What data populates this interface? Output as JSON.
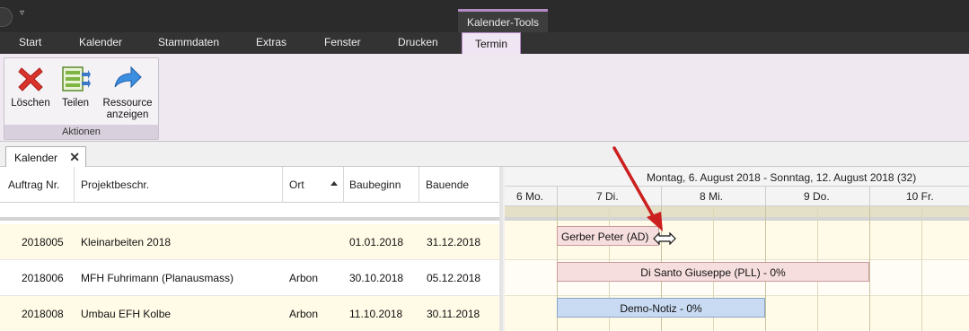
{
  "ribbon_tabs": [
    "Start",
    "Kalender",
    "Stammdaten",
    "Extras",
    "Fenster",
    "Drucken",
    "Termin"
  ],
  "context_group": "Kalender-Tools",
  "actions_group": {
    "label": "Aktionen",
    "buttons": [
      {
        "label": "Löschen",
        "icon": "delete-x-icon"
      },
      {
        "label": "Teilen",
        "icon": "split-icon"
      },
      {
        "label_line1": "Ressource",
        "label_line2": "anzeigen",
        "icon": "arrow-right-icon"
      }
    ]
  },
  "document_tab": {
    "label": "Kalender",
    "close": "✕"
  },
  "grid": {
    "columns": [
      "Auftrag Nr.",
      "Projektbeschr.",
      "Ort",
      "Baubeginn",
      "Bauende"
    ],
    "rows": [
      {
        "auftrag": "2018005",
        "projekt": "Kleinarbeiten 2018",
        "ort": "",
        "beginn": "01.01.2018",
        "ende": "31.12.2018"
      },
      {
        "auftrag": "2018006",
        "projekt": "MFH Fuhrimann (Planausmass)",
        "ort": "Arbon",
        "beginn": "30.10.2018",
        "ende": "05.12.2018"
      },
      {
        "auftrag": "2018008",
        "projekt": "Umbau EFH Kolbe",
        "ort": "Arbon",
        "beginn": "11.10.2018",
        "ende": "30.11.2018"
      }
    ]
  },
  "calendar": {
    "week_range": "Montag, 6. August 2018 - Sonntag, 12. August 2018 (32)",
    "days": [
      "6 Mo.",
      "7 Di.",
      "8 Mi.",
      "9 Do.",
      "10 Fr."
    ],
    "appointments": [
      {
        "label": "Gerber Peter (AD)",
        "color": "#f7dede"
      },
      {
        "label": "Di Santo Giuseppe (PLL) - 0%",
        "color": "#f7dede"
      },
      {
        "label": "Demo-Notiz - 0%",
        "color": "#c9dbf3"
      }
    ]
  },
  "colors": {
    "ribbon_accent": "#b58bc6",
    "row_highlight": "#fffbe6",
    "annotation_arrow": "#cc1f1f"
  }
}
